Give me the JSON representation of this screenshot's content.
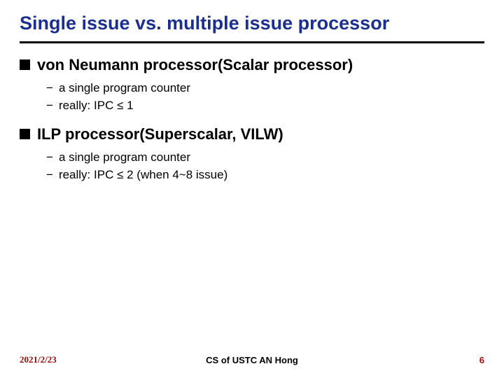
{
  "title": "Single issue vs. multiple issue processor",
  "sections": [
    {
      "heading": "von Neumann processor(Scalar processor)",
      "items": [
        "a single program counter",
        "really: IPC ≤ 1"
      ]
    },
    {
      "heading": "ILP processor(Superscalar, VILW)",
      "items": [
        "a single program counter",
        "really: IPC ≤ 2  (when 4~8 issue)"
      ]
    }
  ],
  "footer": {
    "date": "2021/2/23",
    "center": "CS of USTC AN Hong",
    "page": "6"
  },
  "glyphs": {
    "dash": "−"
  }
}
